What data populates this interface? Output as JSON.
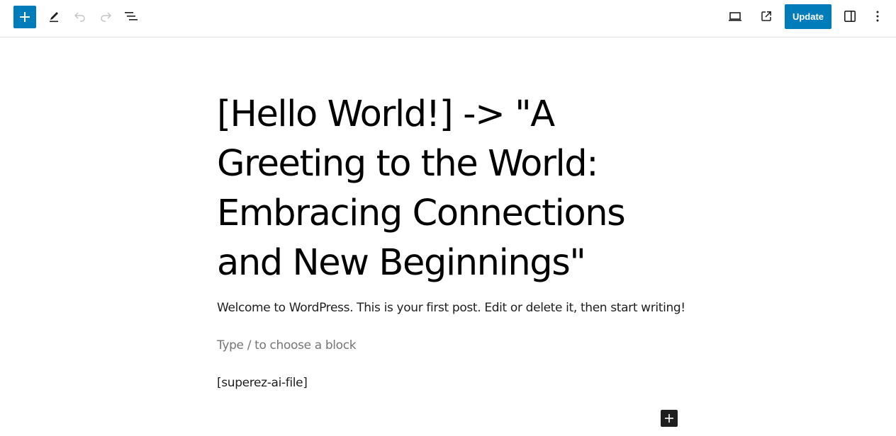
{
  "toolbar": {
    "icons": {
      "inserter": "plus-icon",
      "tools": "pencil-icon",
      "undo": "undo-icon",
      "redo": "redo-icon",
      "list_view": "list-view-icon",
      "preview": "laptop-icon",
      "view_post": "external-link-icon",
      "settings": "sidebar-panel-icon",
      "options": "more-vertical-icon"
    },
    "update_label": "Update"
  },
  "colors": {
    "accent": "#007cba",
    "text": "#1e1e1e",
    "placeholder": "#757575",
    "disabled_icon": "#c4c4c4"
  },
  "editor": {
    "title": "[Hello World!] -> \"A Greeting to the World: Embracing Connections and New Beginnings\"",
    "blocks": {
      "welcome_paragraph": "Welcome to WordPress. This is your first post. Edit or delete it, then start writing!",
      "empty_block_placeholder": "Type / to choose a block",
      "shortcode": "[superez-ai-file]"
    },
    "block_inserter_icon": "plus-icon"
  }
}
